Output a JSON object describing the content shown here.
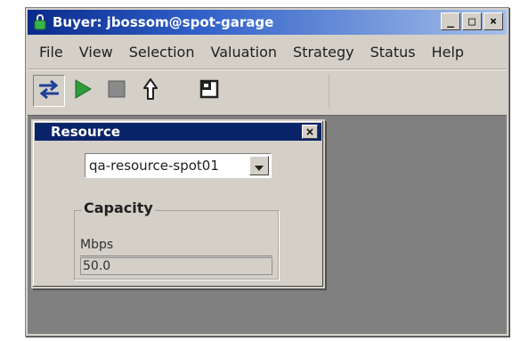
{
  "window": {
    "title": "Buyer: jbossom@spot-garage",
    "controls": {
      "minimize": "_",
      "maximize": "□",
      "close": "×"
    }
  },
  "menu": {
    "items": [
      "File",
      "View",
      "Selection",
      "Valuation",
      "Strategy",
      "Status",
      "Help"
    ]
  },
  "toolbar": {
    "buttons": [
      {
        "icon": "exchange-icon",
        "pressed": true
      },
      {
        "icon": "play-icon",
        "color": "#2e9b3c"
      },
      {
        "icon": "stop-icon",
        "color": "#808080"
      },
      {
        "icon": "bid-arrow-icon"
      },
      {
        "icon": "window-icon"
      }
    ]
  },
  "resource_panel": {
    "title": "Resource",
    "close": "×",
    "resource_select": {
      "value": "qa-resource-spot01"
    },
    "capacity_group": {
      "label": "Capacity",
      "field_label": "Mbps",
      "field_value": "50.0"
    }
  },
  "colors": {
    "title_start": "#0a2a8c",
    "title_end": "#a6c0ea",
    "panel_title": "#0a246a",
    "desktop": "#808080",
    "chrome": "#d4d0c8"
  }
}
